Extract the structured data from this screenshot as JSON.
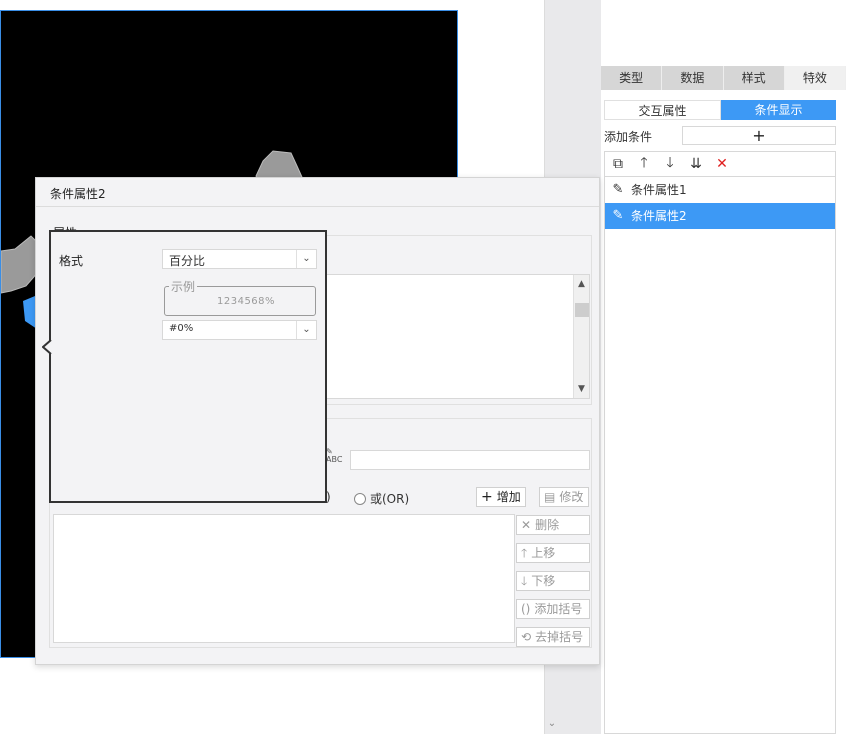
{
  "right_panel": {
    "top_tabs": [
      {
        "label": "类型"
      },
      {
        "label": "数据"
      },
      {
        "label": "样式"
      },
      {
        "label": "特效"
      }
    ],
    "sub_tabs": [
      {
        "label": "交互属性"
      },
      {
        "label": "条件显示"
      }
    ],
    "add_condition_label": "添加条件",
    "add_button_symbol": "+",
    "conditions": [
      {
        "label": "条件属性1"
      },
      {
        "label": "条件属性2"
      }
    ]
  },
  "dialog": {
    "title": "条件属性2",
    "group_label": "属性",
    "or_label": "或(OR)",
    "paren_label": ")",
    "buttons": {
      "add": "增加",
      "modify": "修改",
      "delete": "删除",
      "move_up": "上移",
      "move_down": "下移",
      "add_paren": "添加括号",
      "remove_paren": "去掉括号"
    }
  },
  "format_popup": {
    "format_label": "格式",
    "format_value": "百分比",
    "example_label": "示例",
    "example_value": "1234568%",
    "pattern_value": "#0%"
  },
  "colors": {
    "accent": "#3d99f5",
    "canvas_bg": "#000000",
    "frame_border": "#3a8ee6"
  }
}
